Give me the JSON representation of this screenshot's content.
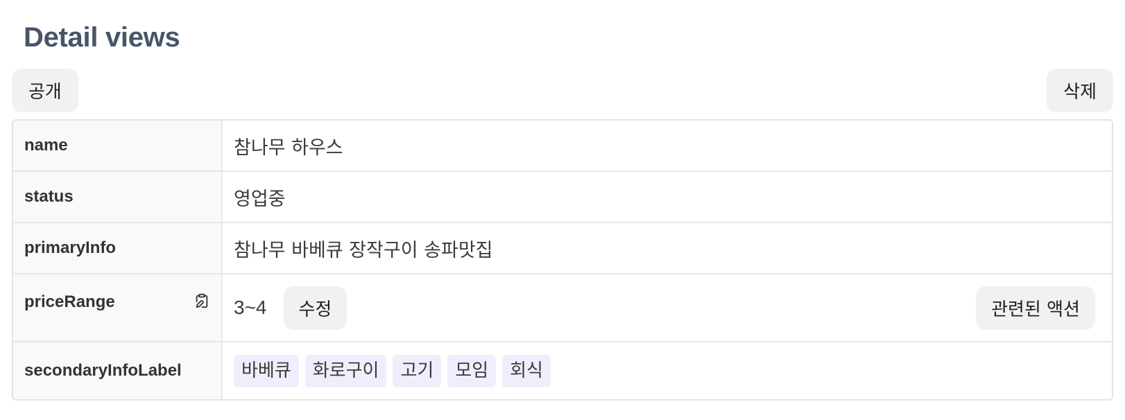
{
  "header": {
    "title": "Detail views"
  },
  "toolbar": {
    "public_label": "공개",
    "delete_label": "삭제"
  },
  "rows": [
    {
      "key": "name",
      "value": "참나무 하우스"
    },
    {
      "key": "status",
      "value": "영업중"
    },
    {
      "key": "primaryInfo",
      "value": "참나무 바베큐 장작구이 송파맛집"
    },
    {
      "key": "priceRange",
      "value": "3~4",
      "icon": "clipboard-edit-icon",
      "edit_label": "수정",
      "related_label": "관련된 액션"
    },
    {
      "key": "secondaryInfoLabel",
      "tags": [
        "바베큐",
        "화로구이",
        "고기",
        "모임",
        "회식"
      ]
    }
  ],
  "colors": {
    "title": "#475569",
    "button_bg": "#f1f1f1",
    "tag_bg": "#efeefc",
    "key_bg": "#f9f9f8",
    "border": "#e6e6e6"
  }
}
